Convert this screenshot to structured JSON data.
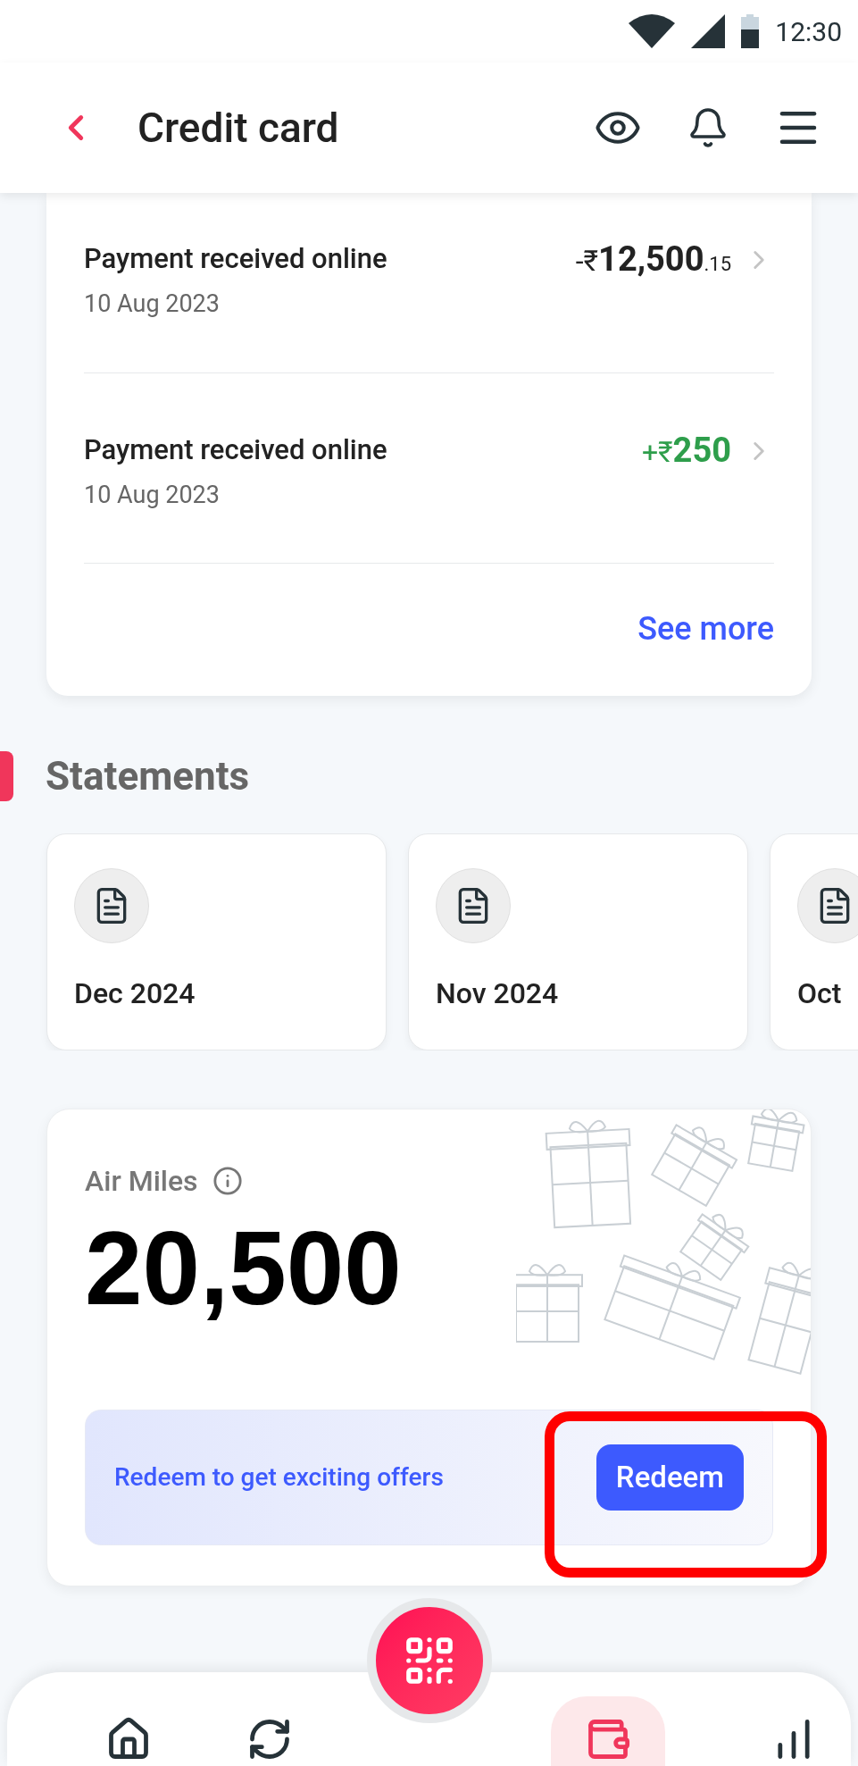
{
  "status_bar": {
    "time": "12:30"
  },
  "header": {
    "title": "Credit card"
  },
  "transactions": [
    {
      "title": "Payment received online",
      "date": "10 Aug 2023",
      "color": "#222222",
      "amount": {
        "prefix": "-₹",
        "main": "12,500",
        "fraction": ".15"
      }
    },
    {
      "title": "Payment received online",
      "date": "10 Aug 2023",
      "color": "#2e9e4b",
      "amount": {
        "prefix": "+₹",
        "main": "250"
      }
    }
  ],
  "see_more": "See more",
  "statements": {
    "title": "Statements",
    "items": [
      {
        "label": "Dec 2024"
      },
      {
        "label": "Nov 2024"
      },
      {
        "label": "Oct"
      }
    ]
  },
  "air_miles": {
    "label": "Air Miles",
    "value": "20,500",
    "promo": "Redeem to get exciting offers",
    "button": "Redeem",
    "button_highlighted": true
  },
  "bottom_nav": [
    {
      "kind": "home",
      "selected": false
    },
    {
      "kind": "transfer",
      "selected": false
    },
    {
      "kind": "wallet",
      "selected": true
    },
    {
      "kind": "invest",
      "selected": false
    }
  ]
}
